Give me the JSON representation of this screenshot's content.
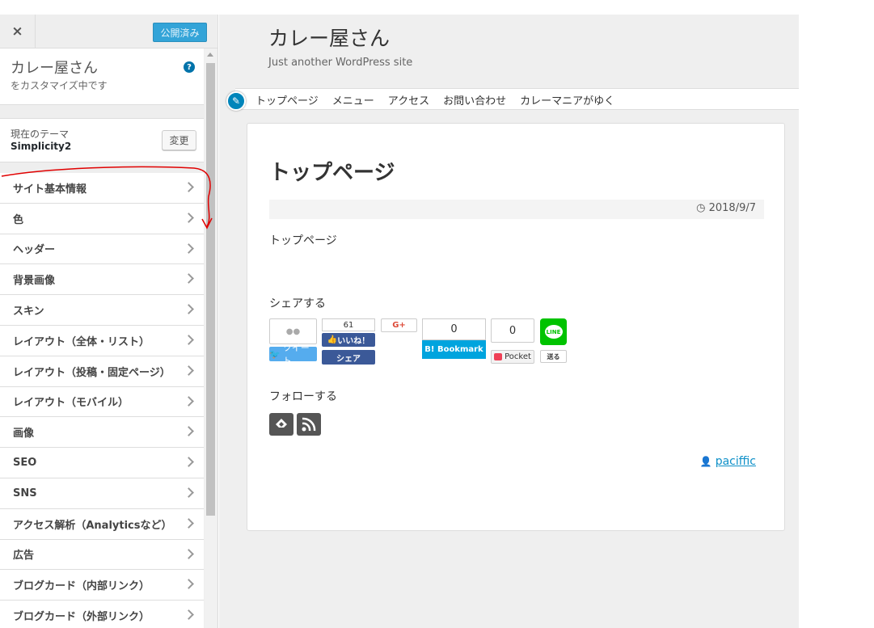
{
  "customizer": {
    "close_label": "×",
    "publish_label": "公開済み",
    "help_label": "?",
    "site_name": "カレー屋さん",
    "customizing_text": "をカスタマイズ中です",
    "theme_label": "現在のテーマ",
    "theme_name": "Simplicity2",
    "change_label": "変更",
    "menu": [
      {
        "label": "サイト基本情報"
      },
      {
        "label": "色"
      },
      {
        "label": "ヘッダー"
      },
      {
        "label": "背景画像"
      },
      {
        "label": "スキン"
      },
      {
        "label": "レイアウト（全体・リスト）"
      },
      {
        "label": "レイアウト（投稿・固定ページ）"
      },
      {
        "label": "レイアウト（モバイル）"
      },
      {
        "label": "画像"
      },
      {
        "label": "SEO"
      },
      {
        "label": "SNS"
      },
      {
        "label": "アクセス解析（Analyticsなど）"
      },
      {
        "label": "広告"
      },
      {
        "label": "ブログカード（内部リンク）"
      },
      {
        "label": "ブログカード（外部リンク）"
      }
    ]
  },
  "preview": {
    "site_title": "カレー屋さん",
    "tagline": "Just another WordPress site",
    "nav": [
      "トップページ",
      "メニュー",
      "アクセス",
      "お問い合わせ",
      "カレーマニアがゆく"
    ],
    "article": {
      "title": "トップページ",
      "date": "2018/9/7",
      "body": "トップページ",
      "share_heading": "シェアする",
      "twitter_label": "ツイート",
      "facebook_count": "61",
      "facebook_like": "いいね！",
      "facebook_share": "シェア",
      "gplus_label": "G+",
      "hatena_count": "0",
      "hatena_label": "B! Bookmark",
      "pocket_count": "0",
      "pocket_label": "Pocket",
      "line_label": "LINE",
      "line_send": "送る",
      "follow_heading": "フォローする",
      "author": "paciffic"
    }
  },
  "colors": {
    "accent": "#0073aa",
    "publish": "#33a4d8",
    "annotation": "#e00000"
  }
}
